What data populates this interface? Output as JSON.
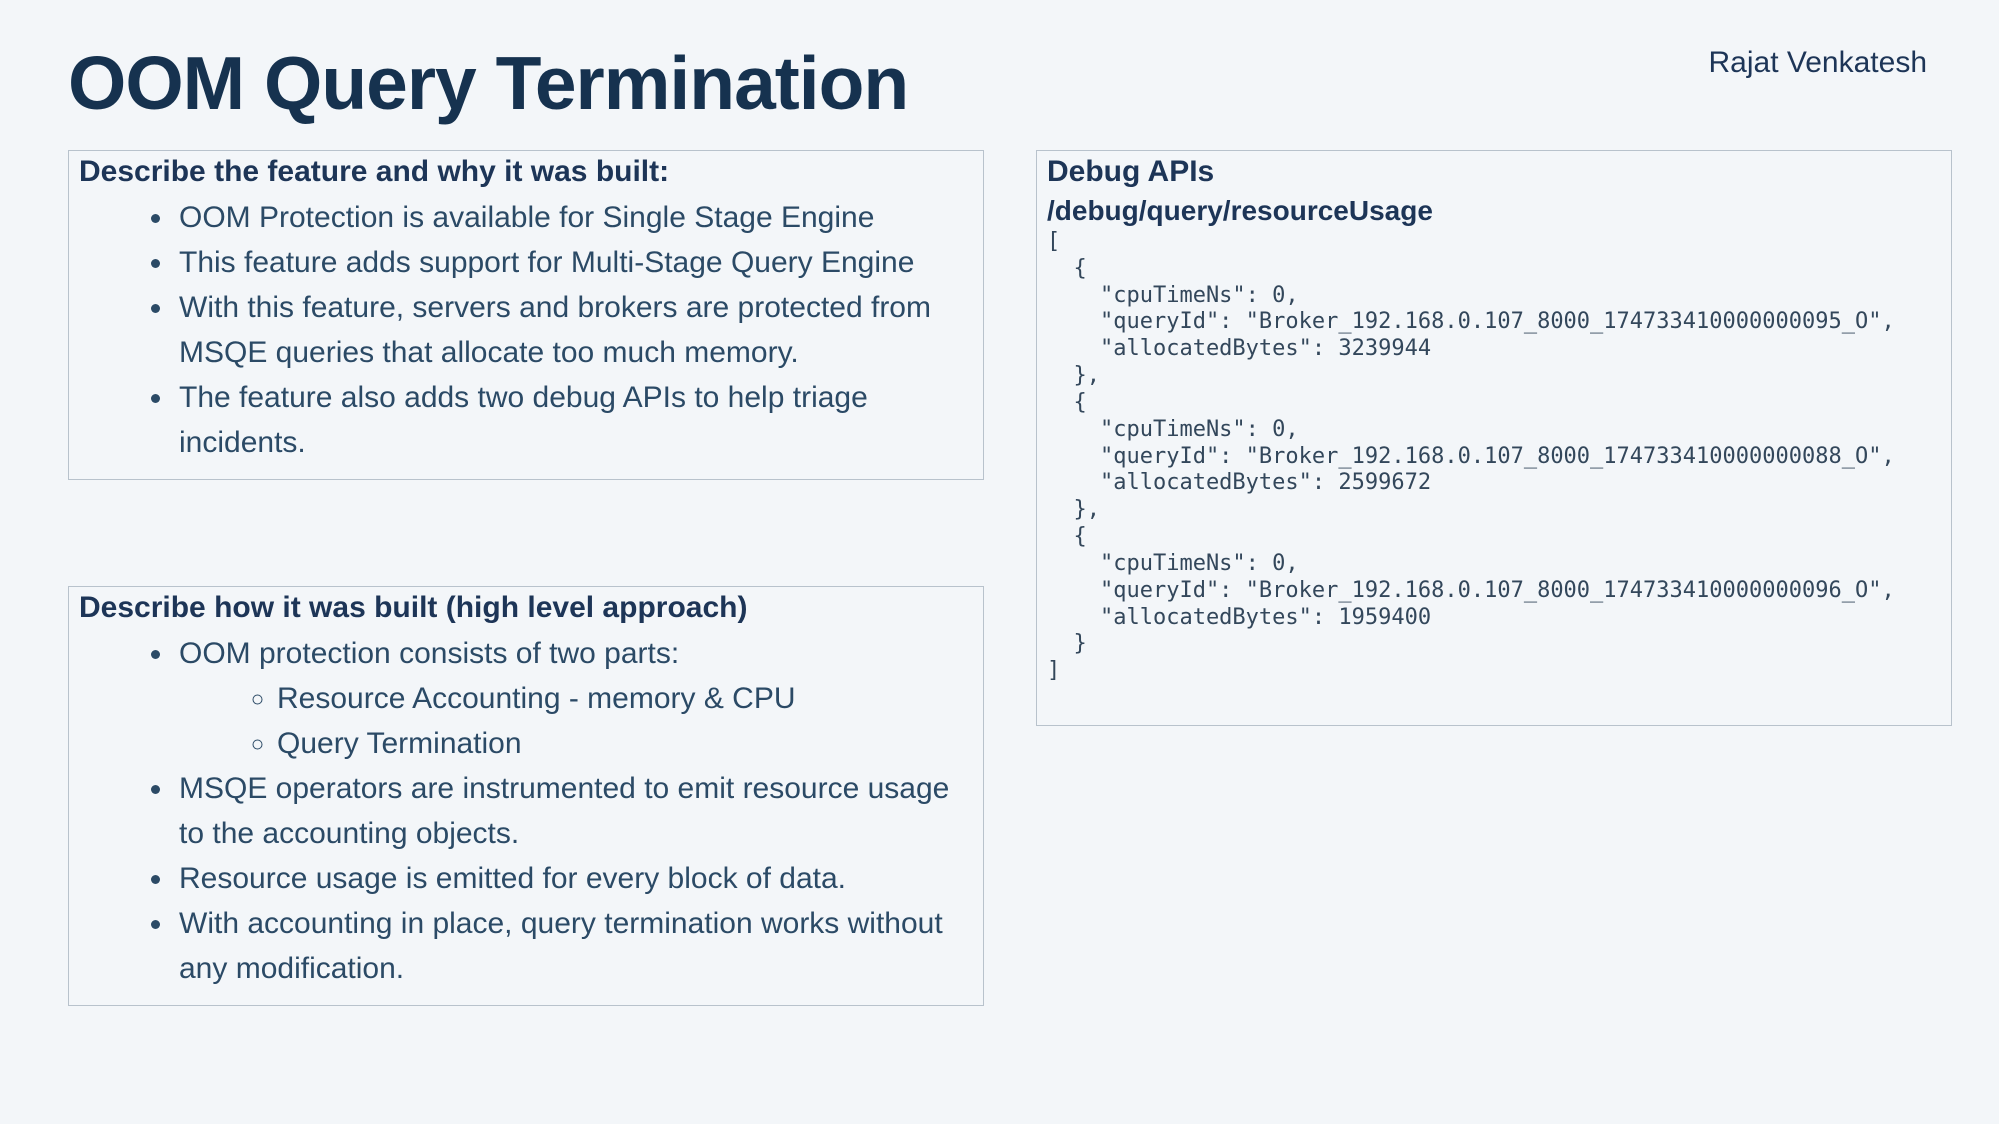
{
  "author": "Rajat Venkatesh",
  "title": "OOM Query Termination",
  "panel_feature": {
    "heading": "Describe the feature and why it was built:",
    "items": [
      "OOM Protection is available for Single Stage Engine",
      "This feature adds support for Multi-Stage Query Engine",
      "With this feature, servers and brokers are protected from MSQE queries that allocate too much memory.",
      "The feature also adds two debug APIs to help triage incidents."
    ]
  },
  "panel_approach": {
    "heading": "Describe how it was built (high level approach)",
    "item0": "OOM protection consists of two parts:",
    "sub0": "Resource Accounting - memory & CPU",
    "sub1": "Query Termination",
    "item1": "MSQE operators are instrumented to emit resource usage to the accounting objects.",
    "item2": "Resource usage is emitted for every block of data.",
    "item3": "With accounting in place, query termination works without any modification."
  },
  "panel_debug": {
    "heading": "Debug APIs",
    "api_path": "/debug/query/resourceUsage",
    "code": "[\n  {\n    \"cpuTimeNs\": 0,\n    \"queryId\": \"Broker_192.168.0.107_8000_174733410000000095_O\",\n    \"allocatedBytes\": 3239944\n  },\n  {\n    \"cpuTimeNs\": 0,\n    \"queryId\": \"Broker_192.168.0.107_8000_174733410000000088_O\",\n    \"allocatedBytes\": 2599672\n  },\n  {\n    \"cpuTimeNs\": 0,\n    \"queryId\": \"Broker_192.168.0.107_8000_174733410000000096_O\",\n    \"allocatedBytes\": 1959400\n  }\n]"
  }
}
